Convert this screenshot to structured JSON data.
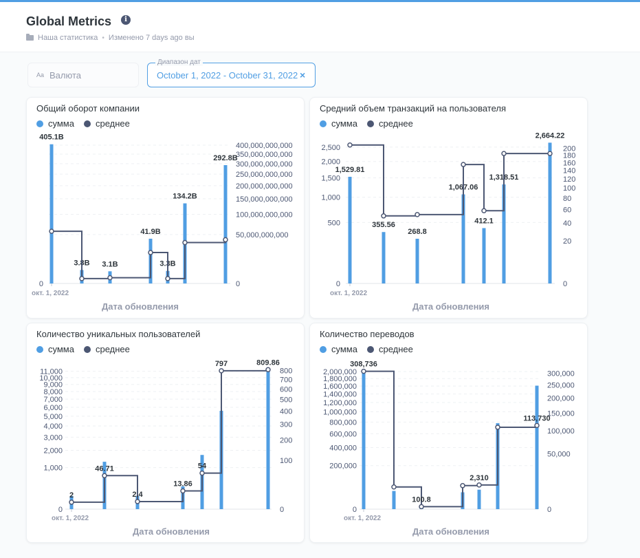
{
  "header": {
    "title": "Global Metrics",
    "collection": "Наша статистика",
    "edited": "Изменено 7 days ago вы"
  },
  "filters": {
    "currency": {
      "prefix": "Aa",
      "placeholder": "Валюта"
    },
    "date_range": {
      "label": "Диапазон дат",
      "value": "October 1, 2022 - October 31, 2022",
      "clear": "×"
    }
  },
  "legend": {
    "sum_label": "сумма",
    "avg_label": "среднее"
  },
  "colors": {
    "sum": "#509ee3",
    "avg": "#4c5773",
    "accent": "#509ee3"
  },
  "cards": [
    {
      "title": "Общий оборот компании",
      "xlabel": "Дата обновления",
      "first_tick": "окт. 1, 2022"
    },
    {
      "title": "Средний объем транзакций на пользователя",
      "xlabel": "Дата обновления",
      "first_tick": "окт. 1, 2022"
    },
    {
      "title": "Количество уникальных пользователей",
      "xlabel": "Дата обновления",
      "first_tick": "окт. 1, 2022"
    },
    {
      "title": "Количество переводов",
      "xlabel": "Дата обновления",
      "first_tick": "окт. 1, 2022"
    }
  ],
  "chart_data": [
    {
      "type": "bar",
      "title": "Общий оборот компании",
      "xlabel": "Дата обновления",
      "x": [
        "2022-10-01",
        "2022-10-05",
        "2022-10-08",
        "2022-10-14",
        "2022-10-16",
        "2022-10-19",
        "2022-10-24"
      ],
      "series": [
        {
          "name": "сумма",
          "axis": "left",
          "values": [
            405100000000,
            3800000000,
            3100000000,
            41900000000,
            3300000000,
            134200000000,
            292800000000
          ],
          "labels": [
            "405.1B",
            "3.8B",
            "3.1B",
            "41.9B",
            "3.3B",
            "134.2B",
            "292.8B"
          ]
        },
        {
          "name": "среднее",
          "axis": "right",
          "style": "step",
          "values": [
            57000000000,
            500000000,
            700000000,
            20000000000,
            500000000,
            35000000000,
            40000000000
          ]
        }
      ],
      "left_axis": {
        "scale": "sqrt",
        "ticks": [],
        "ticks_labels": [
          "0"
        ]
      },
      "right_axis": {
        "scale": "sqrt",
        "range": [
          0,
          420000000000
        ],
        "ticks": [
          0,
          50000000000,
          100000000000,
          150000000000,
          200000000000,
          250000000000,
          300000000000,
          350000000000,
          400000000000
        ],
        "tick_labels": [
          "0",
          "50,000,000,000",
          "100,000,000,000",
          "150,000,000,000",
          "200,000,000,000",
          "250,000,000,000",
          "300,000,000,000",
          "350,000,000,000",
          "400,000,000,000"
        ]
      }
    },
    {
      "type": "bar",
      "title": "Средний объем транзакций на пользователя",
      "xlabel": "Дата обновления",
      "x": [
        "2022-10-01",
        "2022-10-08",
        "2022-10-15",
        "2022-10-24",
        "2022-10-27",
        "2022-10-31",
        "2022-11-08"
      ],
      "series": [
        {
          "name": "сумма",
          "axis": "left",
          "values": [
            1529.81,
            355.56,
            268.8,
            1067.06,
            412.1,
            1318.51,
            2664.22
          ],
          "labels": [
            "1,529.81",
            "355.56",
            "268.8",
            "1,067.06",
            "412.1",
            "1,318.51",
            "2,664.22"
          ]
        },
        {
          "name": "среднее",
          "axis": "right",
          "style": "step",
          "values": [
            210,
            50,
            52,
            155,
            58,
            185,
            185
          ]
        }
      ],
      "left_axis": {
        "scale": "sqrt",
        "ticks": [
          0,
          500,
          1000,
          1500,
          2000,
          2500
        ],
        "tick_labels": [
          "0",
          "500",
          "1,000",
          "1,500",
          "2,000",
          "2,500"
        ]
      },
      "right_axis": {
        "scale": "sqrt",
        "range": [
          0,
          220
        ],
        "ticks": [
          0,
          20,
          40,
          60,
          80,
          100,
          120,
          140,
          160,
          180,
          200
        ],
        "tick_labels": [
          "0",
          "20",
          "40",
          "60",
          "80",
          "100",
          "120",
          "140",
          "160",
          "180",
          "200"
        ]
      }
    },
    {
      "type": "bar",
      "title": "Количество уникальных пользователей",
      "xlabel": "Дата обновления",
      "x": [
        "2022-10-01",
        "2022-10-08",
        "2022-10-15",
        "2022-10-24",
        "2022-10-28",
        "2022-11-01",
        "2022-11-11"
      ],
      "series": [
        {
          "name": "сумма",
          "axis": "left",
          "values": [
            100,
            1300,
            100,
            300,
            1700,
            5600,
            11200
          ],
          "labels": []
        },
        {
          "name": "среднее",
          "axis": "right",
          "style": "step",
          "values": [
            2,
            46.71,
            2.4,
            13.86,
            54,
            797,
            809.86
          ],
          "labels": [
            "2",
            "46.71",
            "2.4",
            "13.86",
            "54",
            "797",
            "809.86"
          ]
        }
      ],
      "left_axis": {
        "scale": "sqrt",
        "range": [
          0,
          11400
        ],
        "ticks": [
          0,
          1000,
          2000,
          3000,
          4000,
          5000,
          6000,
          7000,
          8000,
          9000,
          10000,
          11000
        ],
        "tick_labels": [
          "0",
          "1,000",
          "2,000",
          "3,000",
          "4,000",
          "5,000",
          "6,000",
          "7,000",
          "8,000",
          "9,000",
          "10,000",
          "11,000"
        ]
      },
      "right_axis": {
        "scale": "sqrt",
        "range": [
          0,
          820
        ],
        "ticks": [
          0,
          100,
          200,
          300,
          400,
          500,
          600,
          700,
          800
        ],
        "tick_labels": [
          "0",
          "100",
          "200",
          "300",
          "400",
          "500",
          "600",
          "700",
          "800"
        ]
      }
    },
    {
      "type": "bar",
      "title": "Количество переводов",
      "xlabel": "Дата обновления",
      "x": [
        "2022-10-01",
        "2022-10-08",
        "2022-10-15",
        "2022-10-24",
        "2022-10-28",
        "2022-11-01",
        "2022-11-11"
      ],
      "series": [
        {
          "name": "сумма",
          "axis": "left",
          "values": [
            2050000,
            35000,
            1000,
            30000,
            40000,
            780000,
            1610000
          ],
          "labels": []
        },
        {
          "name": "среднее",
          "axis": "right",
          "style": "step",
          "values": [
            308736,
            8000,
            100.8,
            9000,
            9500,
            109000,
            113730
          ],
          "labels": [
            "308,736",
            "",
            "100.8",
            "",
            "2,310",
            "",
            "113,730"
          ]
        }
      ],
      "left_axis": {
        "scale": "sqrt",
        "range": [
          0,
          2080000
        ],
        "ticks": [
          0,
          200000,
          400000,
          600000,
          800000,
          1000000,
          1200000,
          1400000,
          1600000,
          1800000,
          2000000
        ],
        "tick_labels": [
          "0",
          "200,000",
          "400,000",
          "600,000",
          "800,000",
          "1,000,000",
          "1,200,000",
          "1,400,000",
          "1,600,000",
          "1,800,000",
          "2,000,000"
        ]
      },
      "right_axis": {
        "scale": "sqrt",
        "range": [
          0,
          320000
        ],
        "ticks": [
          0,
          50000,
          100000,
          150000,
          200000,
          250000,
          300000
        ],
        "tick_labels": [
          "0",
          "50,000",
          "100,000",
          "150,000",
          "200,000",
          "250,000",
          "300,000"
        ]
      }
    }
  ]
}
